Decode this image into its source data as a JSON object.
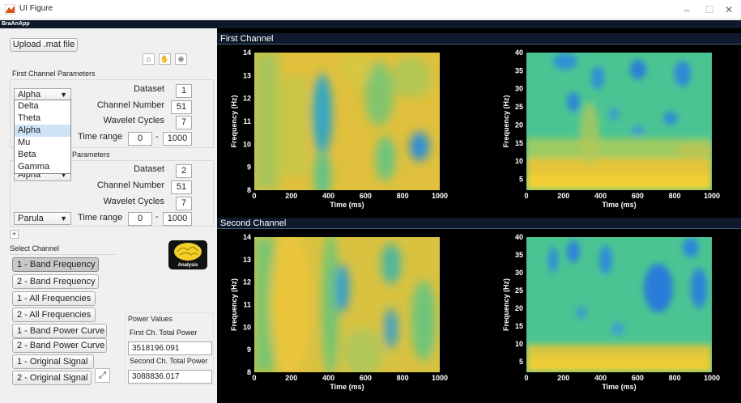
{
  "window": {
    "title": "UI Figure",
    "minimize": "–",
    "maximize": "☐",
    "close": "✕"
  },
  "menu": {
    "app_name": "BraAnApp"
  },
  "left": {
    "upload_label": "Upload .mat file",
    "tools": [
      "home-icon",
      "pan-hand-icon",
      "zoom-in-icon"
    ],
    "first_params": {
      "heading": "First Channel Parameters",
      "band": "Alpha",
      "dataset_label": "Dataset",
      "dataset": "1",
      "channel_label": "Channel Number",
      "channel": "51",
      "cycles_label": "Wavelet Cycles",
      "cycles": "7",
      "time_label": "Time range",
      "time_from": "0",
      "time_to": "1000",
      "time_dash": "-"
    },
    "band_options": [
      "Delta",
      "Theta",
      "Alpha",
      "Mu",
      "Beta",
      "Gamma"
    ],
    "band_selected_index": 2,
    "second_params": {
      "heading_partial": "Parameters",
      "band_partial": "Alpha",
      "dataset_label": "Dataset",
      "dataset": "2",
      "channel_label": "Channel Number",
      "channel": "51",
      "cycles_label": "Wavelet Cycles",
      "cycles": "7",
      "time_label": "Time range",
      "time_from": "0",
      "time_to": "1000",
      "time_dash": "-",
      "colormap": "Parula"
    },
    "select_channel_label": "Select Channel",
    "analysis_label": "Analysis",
    "channel_buttons": [
      "1 - Band Frequency",
      "2 - Band Frequency",
      "1 - All Frequencies",
      "2 - All Frequencies",
      "1 - Band Power Curve",
      "2 - Band Power Curve",
      "1 - Original Signal",
      "2 - Original Signal"
    ],
    "selected_button_index": 0,
    "power": {
      "heading": "Power Values",
      "first_label": "First Ch. Total Power",
      "first_value": "3518196.091",
      "second_label": "Second Ch. Total Power",
      "second_value": "3088836.017"
    }
  },
  "plots": {
    "first_channel_title": "First Channel",
    "second_channel_title": "Second Channel",
    "xlabel": "Time (ms)",
    "ylabel": "Frequency (Hz)",
    "band_yticks": [
      "8",
      "9",
      "10",
      "11",
      "12",
      "13",
      "14"
    ],
    "band_ylim": [
      8,
      14
    ],
    "all_yticks": [
      "5",
      "10",
      "15",
      "20",
      "25",
      "30",
      "35",
      "40"
    ],
    "all_ylim": [
      2,
      40
    ],
    "xticks": [
      "0",
      "200",
      "400",
      "600",
      "800",
      "1000"
    ],
    "xlim": [
      0,
      1000
    ],
    "colors": {
      "bg": "#000000",
      "yellow": "#e3c63a",
      "green": "#4bc493",
      "blue": "#2f7fd8"
    }
  }
}
